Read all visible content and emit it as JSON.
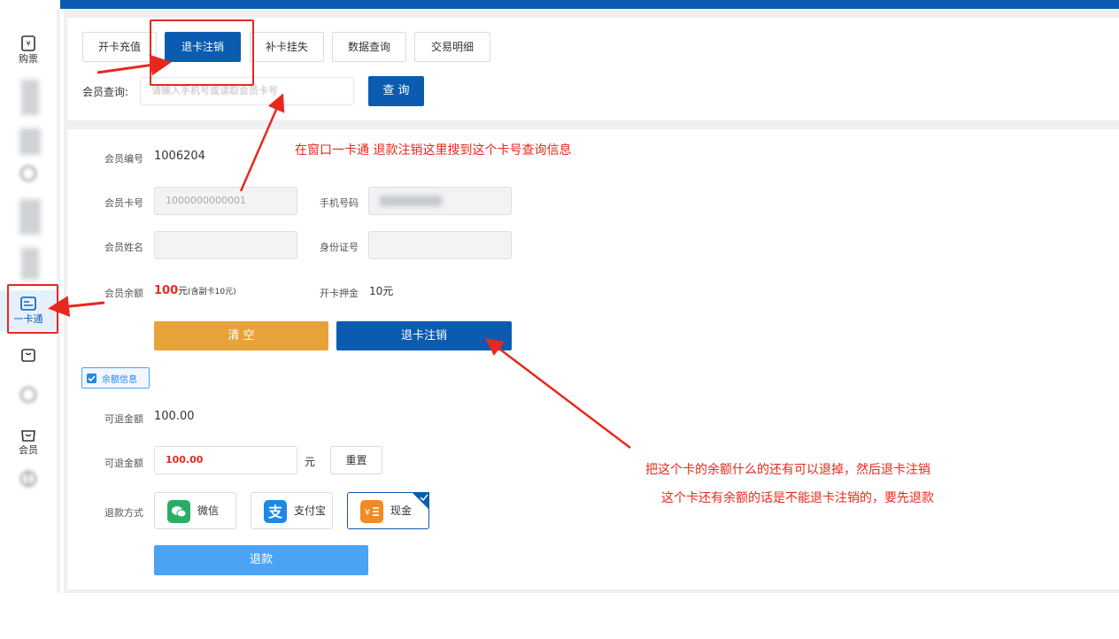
{
  "sidebar": {
    "items": [
      {
        "label": "购票",
        "icon": "ticket-icon"
      },
      {
        "label": "",
        "icon": "blurred-icon"
      },
      {
        "label": "",
        "icon": "blurred-icon"
      },
      {
        "label": "",
        "icon": "blurred-icon"
      },
      {
        "label": "",
        "icon": "blurred-icon"
      },
      {
        "label": "",
        "icon": "blurred-icon"
      },
      {
        "label": "一卡通",
        "icon": "card-icon"
      },
      {
        "label": "",
        "icon": "bag-icon"
      },
      {
        "label": "",
        "icon": "blurred-icon"
      },
      {
        "label": "会员",
        "icon": "member-icon"
      },
      {
        "label": "",
        "icon": "blurred-icon"
      }
    ]
  },
  "tabs": [
    {
      "label": "开卡充值"
    },
    {
      "label": "退卡注销"
    },
    {
      "label": "补卡挂失"
    },
    {
      "label": "数据查询"
    },
    {
      "label": "交易明细"
    }
  ],
  "search": {
    "label": "会员查询:",
    "placeholder": "请输入手机号或读取会员卡号",
    "button": "查 询"
  },
  "member": {
    "id_label": "会员编号",
    "id_value": "1006204",
    "card_label": "会员卡号",
    "card_value": "1000000000001",
    "phone_label": "手机号码",
    "name_label": "会员姓名",
    "idcard_label": "身份证号",
    "balance_label": "会员余额",
    "balance_value": "100",
    "balance_suffix": "元",
    "balance_note": "(含副卡10元)",
    "deposit_label": "开卡押金",
    "deposit_value": "10元"
  },
  "actions": {
    "clear": "清 空",
    "cancel_card": "退卡注销"
  },
  "balance_section": {
    "checkbox_label": "余额信息",
    "refundable_label": "可退金额",
    "refundable_value": "100.00",
    "refund_input_label": "可退金额",
    "refund_input_value": "100.00",
    "unit": "元",
    "reset": "重置",
    "method_label": "退款方式",
    "methods": [
      {
        "label": "微信",
        "icon": "wechat-icon"
      },
      {
        "label": "支付宝",
        "icon": "alipay-icon"
      },
      {
        "label": "现金",
        "icon": "cash-icon"
      }
    ],
    "refund_button": "退款"
  },
  "annotations": {
    "note1": "在窗口一卡通  退款注销这里搜到这个卡号查询信息",
    "note2_line1": "把这个卡的余额什么的还有可以退掉，然后退卡注销",
    "note2_line2": "这个卡还有余额的话是不能退卡注销的，要先退款"
  },
  "colors": {
    "primary": "#0b5bb0",
    "orange": "#e8a23a",
    "light_blue": "#4ba3f5",
    "annotation_red": "#e8281e"
  }
}
